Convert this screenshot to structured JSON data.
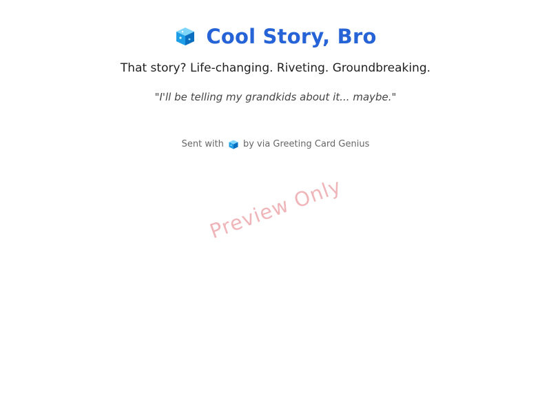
{
  "card": {
    "icon": "ice-cube-icon",
    "title": "Cool Story, Bro",
    "subtitle": "That story? Life-changing. Riveting. Groundbreaking.",
    "quote": "\"I'll be telling my grandkids about it... maybe.\"",
    "footer": {
      "prefix": "Sent with",
      "icon": "ice-cube-icon",
      "suffix": "by via Greeting Card Genius"
    }
  },
  "watermark": "Preview Only",
  "colors": {
    "title": "#2563d6",
    "cube_light": "#5fc6f5",
    "cube_mid": "#1e9ee6",
    "cube_dark": "#0a6fbf",
    "watermark": "#dc5a64"
  }
}
